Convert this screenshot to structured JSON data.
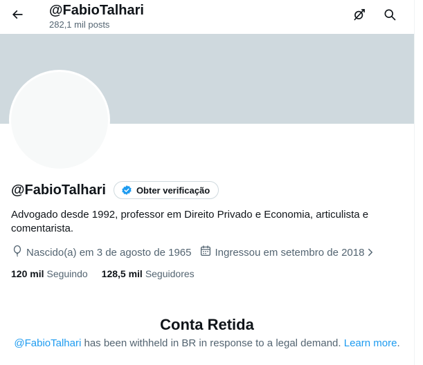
{
  "header": {
    "title": "@FabioTalhari",
    "post_count": "282,1 mil posts",
    "back_icon": "arrow-left-icon",
    "grok_icon": "grok-icon",
    "search_icon": "search-icon"
  },
  "profile": {
    "display_name": "@FabioTalhari",
    "verify_label": "Obter verificação",
    "verify_icon": "verified-badge-icon",
    "bio": "Advogado desde 1992, professor em Direito Privado e Economia, articulista e comentarista.",
    "birth": "Nascido(a) em 3 de agosto de 1965",
    "birth_icon": "balloon-icon",
    "joined": "Ingressou em setembro de 2018",
    "joined_icon": "calendar-icon",
    "following_count": "120 mil",
    "following_label": "Seguindo",
    "followers_count": "128,5 mil",
    "followers_label": "Seguidores"
  },
  "withheld": {
    "title": "Conta Retida",
    "handle_link": "@FabioTalhari",
    "message": " has been withheld in BR in response to a legal demand. ",
    "learn_more": "Learn more",
    "period": "."
  },
  "colors": {
    "banner": "#cfd9de",
    "accent": "#1d9bf0",
    "secondary_text": "#536471"
  }
}
